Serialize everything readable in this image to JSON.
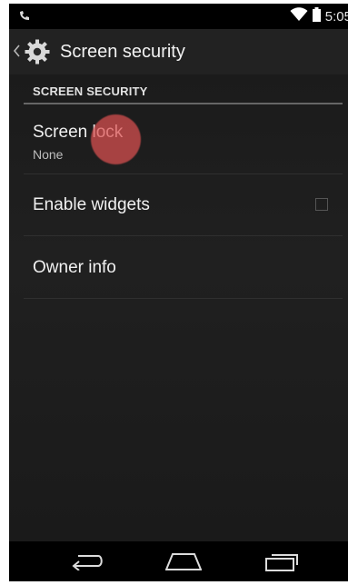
{
  "status_bar": {
    "time": "5:05",
    "icons": [
      "voicemail-icon",
      "wifi-icon",
      "battery-icon"
    ]
  },
  "action_bar": {
    "up_icon": "chevron-left-icon",
    "app_icon": "settings-gear-icon",
    "title": "Screen security"
  },
  "section": {
    "header": "SCREEN SECURITY"
  },
  "settings": [
    {
      "title": "Screen lock",
      "summary": "None"
    },
    {
      "title": "Enable widgets",
      "checked": false
    },
    {
      "title": "Owner info"
    }
  ],
  "nav_bar": {
    "buttons": [
      "back-icon",
      "home-icon",
      "recent-apps-icon"
    ]
  },
  "colors": {
    "action_bar": "#222222",
    "background": "#1e1e1e",
    "touch_indicator": "#dc5050"
  }
}
